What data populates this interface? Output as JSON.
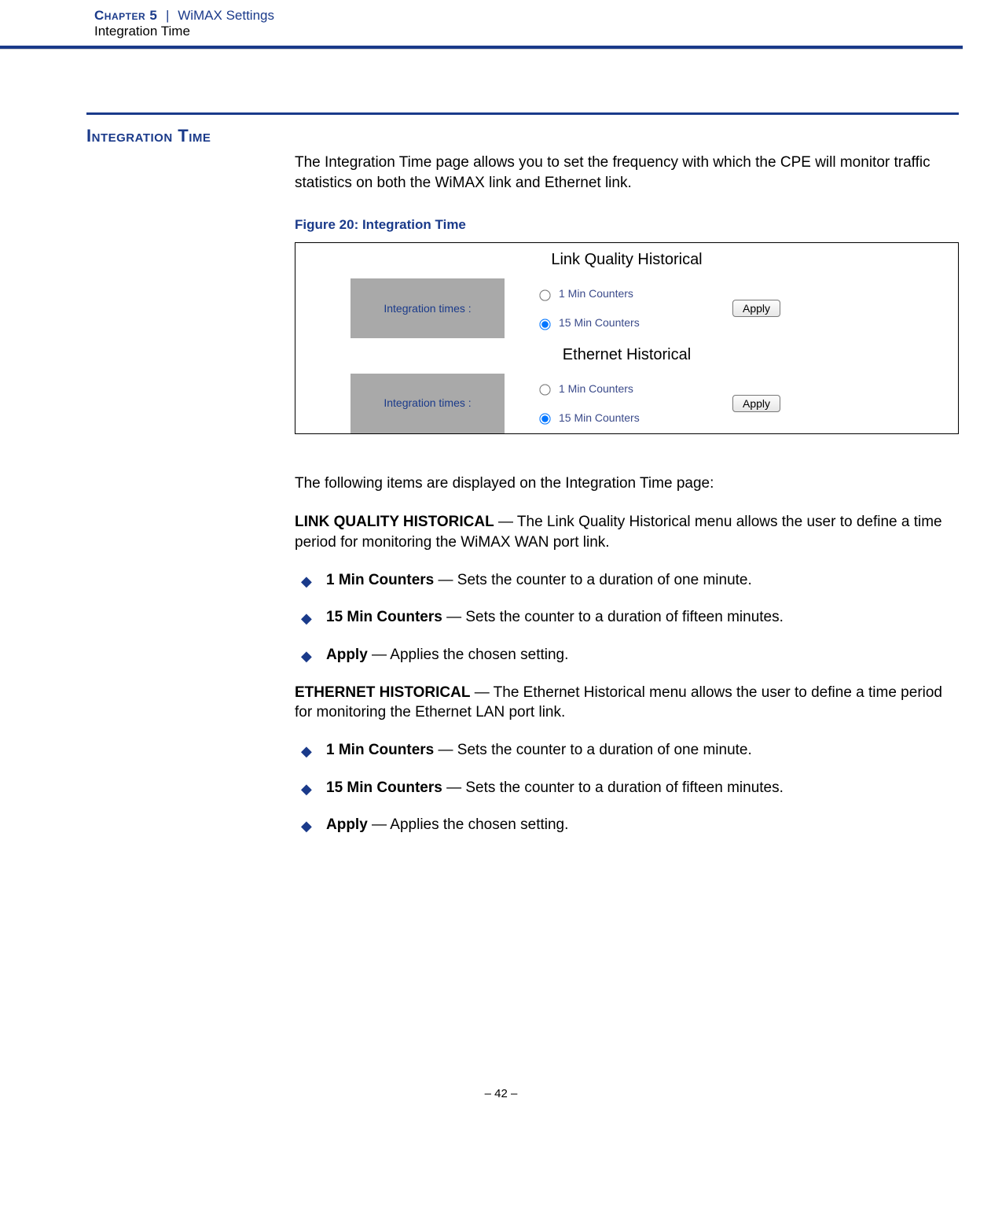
{
  "header": {
    "chapter_label": "Chapter 5",
    "separator": "|",
    "chapter_title": "WiMAX Settings",
    "sub": "Integration Time"
  },
  "section_heading": "Integration Time",
  "intro": "The Integration Time page allows you to set the frequency with which the CPE will monitor traffic statistics on both the WiMAX link and Ethernet link.",
  "figure_caption": "Figure 20:  Integration Time",
  "figure": {
    "panels": [
      {
        "title": "Link Quality Historical",
        "row_label": "Integration times :",
        "options": [
          "1 Min Counters",
          "15 Min Counters"
        ],
        "selected": "15 Min Counters",
        "apply": "Apply"
      },
      {
        "title": "Ethernet Historical",
        "row_label": "Integration times :",
        "options": [
          "1 Min Counters",
          "15 Min Counters"
        ],
        "selected": "15 Min Counters",
        "apply": "Apply"
      }
    ]
  },
  "desc_following": "The following items are displayed on the Integration Time page:",
  "groups": [
    {
      "heading": "LINK QUALITY HISTORICAL",
      "heading_desc": " — The Link Quality Historical menu allows the user to define a time period for monitoring the WiMAX WAN port link.",
      "items": [
        {
          "term": "1 Min Counters",
          "desc": " — Sets the counter to a duration of one minute."
        },
        {
          "term": "15 Min Counters",
          "desc": " — Sets the counter to a duration of fifteen minutes."
        },
        {
          "term": "Apply",
          "desc": " — Applies the chosen setting."
        }
      ]
    },
    {
      "heading": "ETHERNET HISTORICAL",
      "heading_desc": " — The Ethernet Historical menu allows the user to define a time period for monitoring the Ethernet LAN port link.",
      "items": [
        {
          "term": "1 Min Counters",
          "desc": " — Sets the counter to a duration of one minute."
        },
        {
          "term": "15 Min Counters",
          "desc": " — Sets the counter to a duration of fifteen minutes."
        },
        {
          "term": "Apply",
          "desc": " — Applies the chosen setting."
        }
      ]
    }
  ],
  "footer": "–  42  –"
}
